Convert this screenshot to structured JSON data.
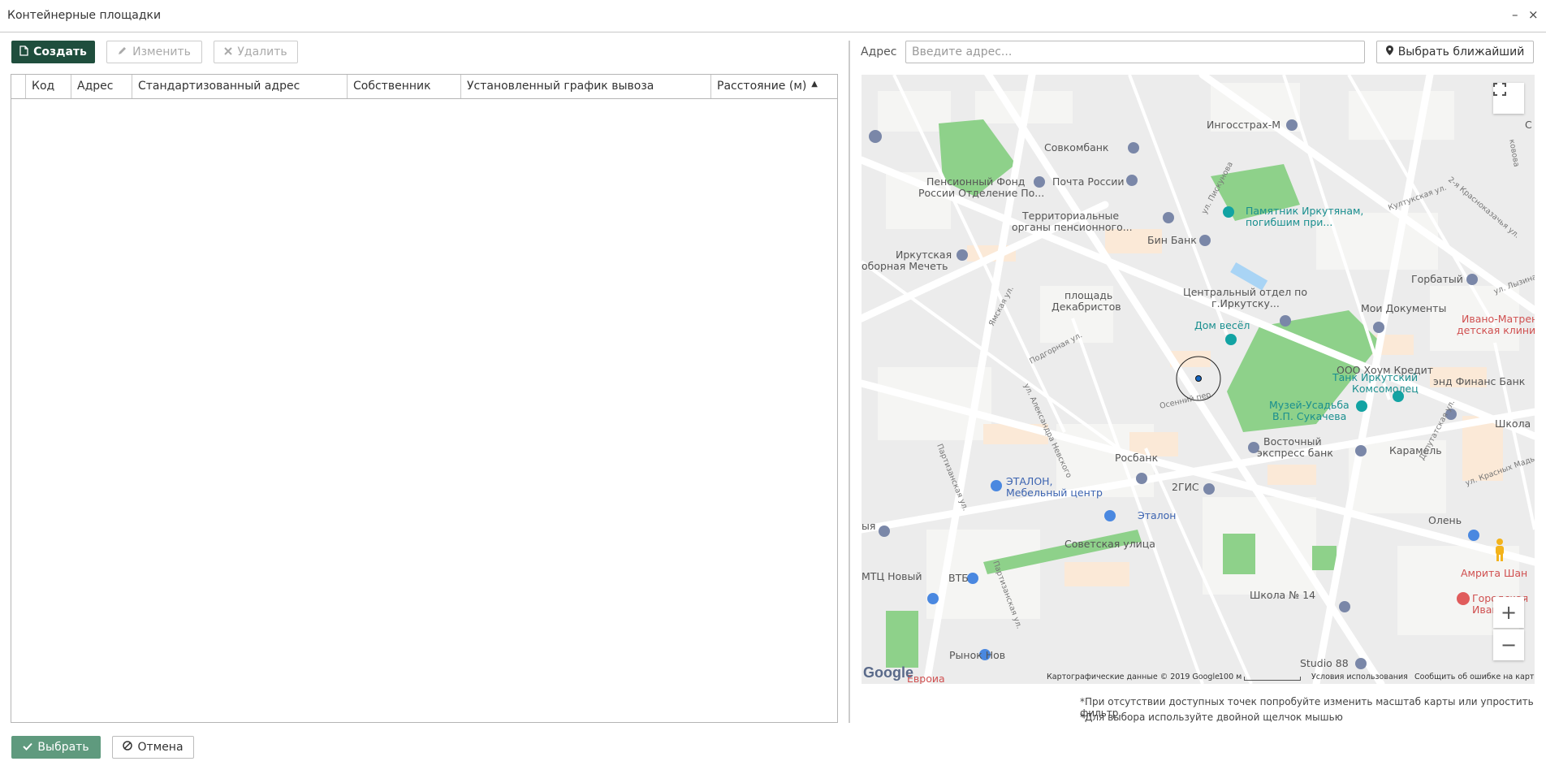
{
  "window": {
    "title": "Контейнерные площадки",
    "minimize": "–",
    "close": "×"
  },
  "toolbar": {
    "create": "Создать",
    "edit": "Изменить",
    "delete": "Удалить"
  },
  "table": {
    "columns": [
      "Код",
      "Адрес",
      "Стандартизованный адрес",
      "Собственник",
      "Установленный график вывоза",
      "Расстояние (м)"
    ],
    "sort_indicator": "▲",
    "rows": []
  },
  "address": {
    "label": "Адрес",
    "placeholder": "Введите адрес...",
    "nearest": "Выбрать ближайший"
  },
  "map": {
    "labels": [
      "Ингосстрах-М",
      "Совкомбанк",
      "Пенсионный Фонд",
      "России Отделение По...",
      "Почта России",
      "Территориальные",
      "органы пенсионного...",
      "Памятник Иркутянам,",
      "погибшим при...",
      "Бин Банк",
      "Иркутская",
      "оборная Мечеть",
      "Горбатый",
      "площадь",
      "Декабристов",
      "Центральный отдел по",
      "г.Иркутску...",
      "Мои Документы",
      "Ивано-Матрен",
      "детская клини",
      "Дом весёл",
      "Танк Иркутский",
      "Комсомолец",
      "ООО Хоум Кредит",
      "энд Финанс Банк",
      "Музей-Усадьба",
      "В.П. Сукачева",
      "Школа N",
      "Восточный",
      "экспресс банк",
      "Росбанк",
      "Карамель",
      "ЭТАЛОН,",
      "Мебельный центр",
      "2ГИС",
      "Эталон",
      "Олень",
      "Советская улица",
      "ВТБ",
      "Амрита Шан",
      "Городская",
      "Ивано-Ма",
      "МТЦ Новый",
      "Школа № 14",
      "Рынок Нов",
      "Studio 88",
      "Евроиа",
      "ул. Пискунова",
      "Ямская ул.",
      "Подгорная ул.",
      "ул. Александра Невского",
      "Осенний пер.",
      "Партизанская ул.",
      "Депутатская ул.",
      "Култукская ул.",
      "2-я Красноказачья ул.",
      "ул. Лызина",
      "ул. Красных Мадьяр",
      "ыя",
      "С",
      "ковова"
    ],
    "footer": {
      "data": "Картографические данные © 2019 Google",
      "scale": "100 м",
      "terms": "Условия использования",
      "report": "Сообщить об ошибке на карте"
    },
    "logo": "Google",
    "zoom_in": "+",
    "zoom_out": "−"
  },
  "notes": [
    "*При отсутствии доступных точек попробуйте изменить масштаб карты или упростить фильтр.",
    "*Для выбора используйте двойной щелчок мышью"
  ],
  "bottom": {
    "select": "Выбрать",
    "cancel": "Отмена"
  }
}
